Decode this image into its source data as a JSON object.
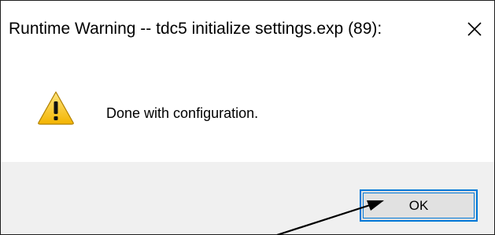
{
  "dialog": {
    "title": "Runtime Warning -- tdc5 initialize settings.exp (89):",
    "close_icon": "close-icon",
    "message_icon": "warning-icon",
    "message": "Done with configuration.",
    "ok_label": "OK"
  },
  "colors": {
    "footer_bg": "#f0f0f0",
    "focus_border": "#0078d7",
    "button_bg": "#e1e1e1",
    "warning_yellow": "#f8c51c",
    "annotation_arrow": "#000000"
  }
}
